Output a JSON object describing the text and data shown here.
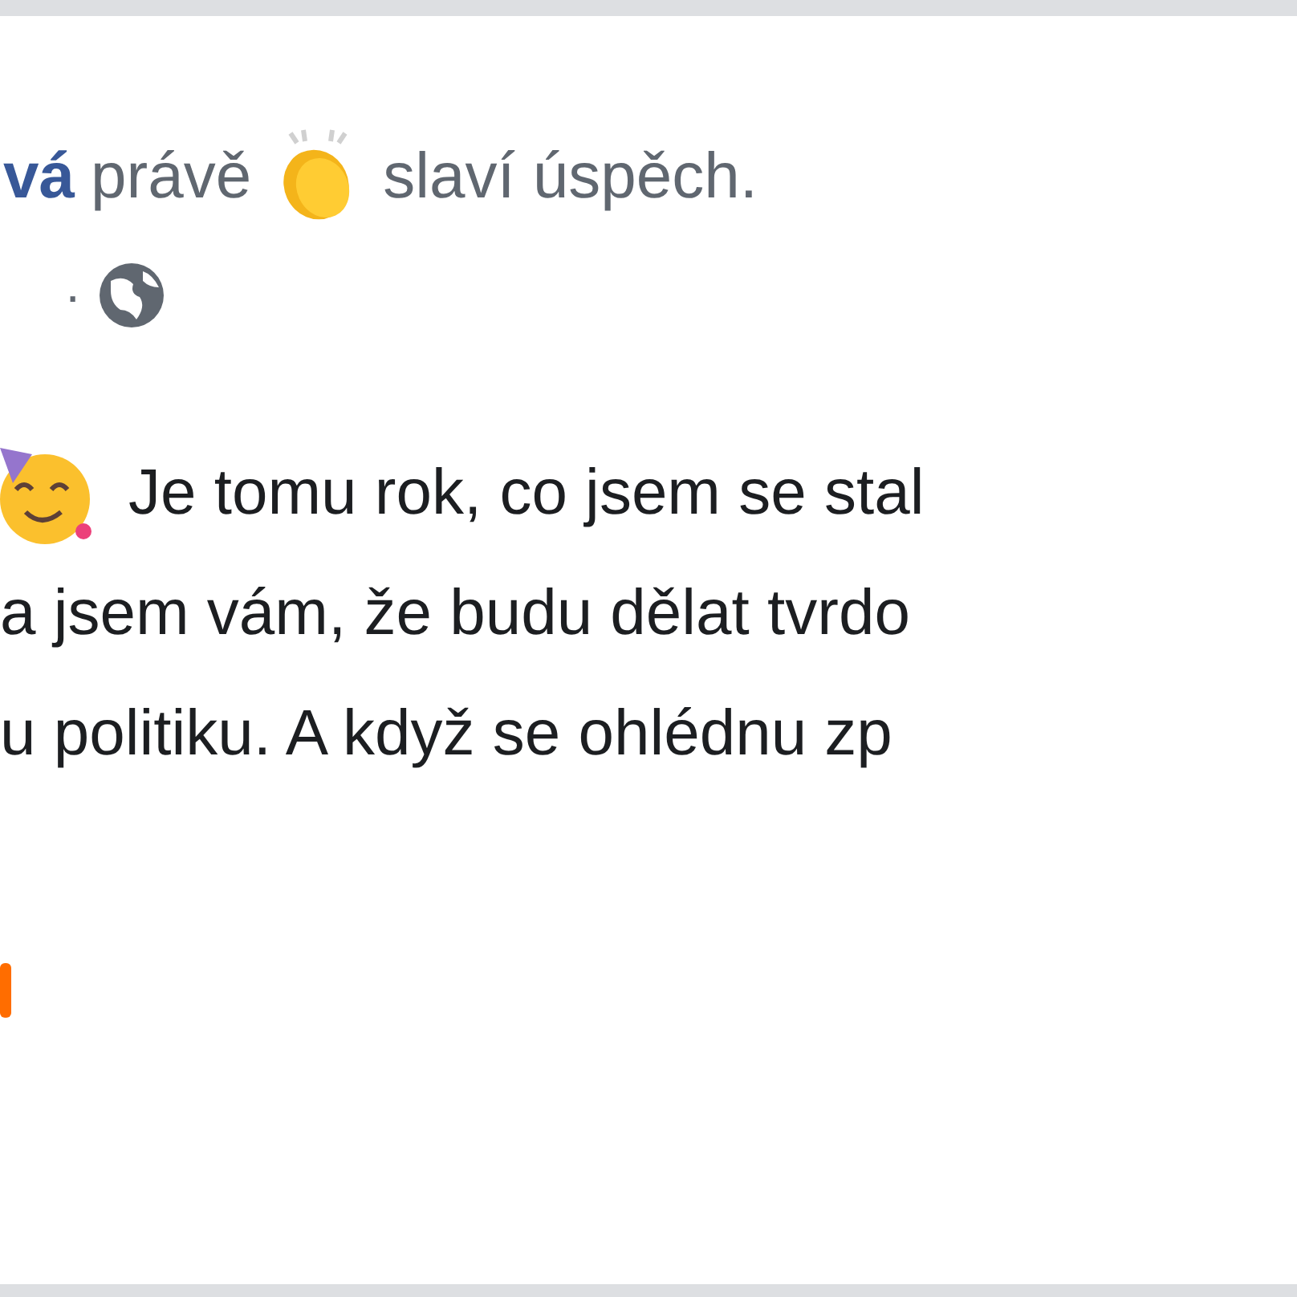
{
  "post": {
    "header": {
      "author": "vá",
      "verb": "právě",
      "activity": "slaví úspěch."
    },
    "meta": {
      "separator": "·"
    },
    "body_lines": [
      "Je tomu rok, co jsem se stal",
      "a jsem vám, že budu dělat tvrdo",
      "u politiku. A když se ohlédnu zp"
    ]
  }
}
